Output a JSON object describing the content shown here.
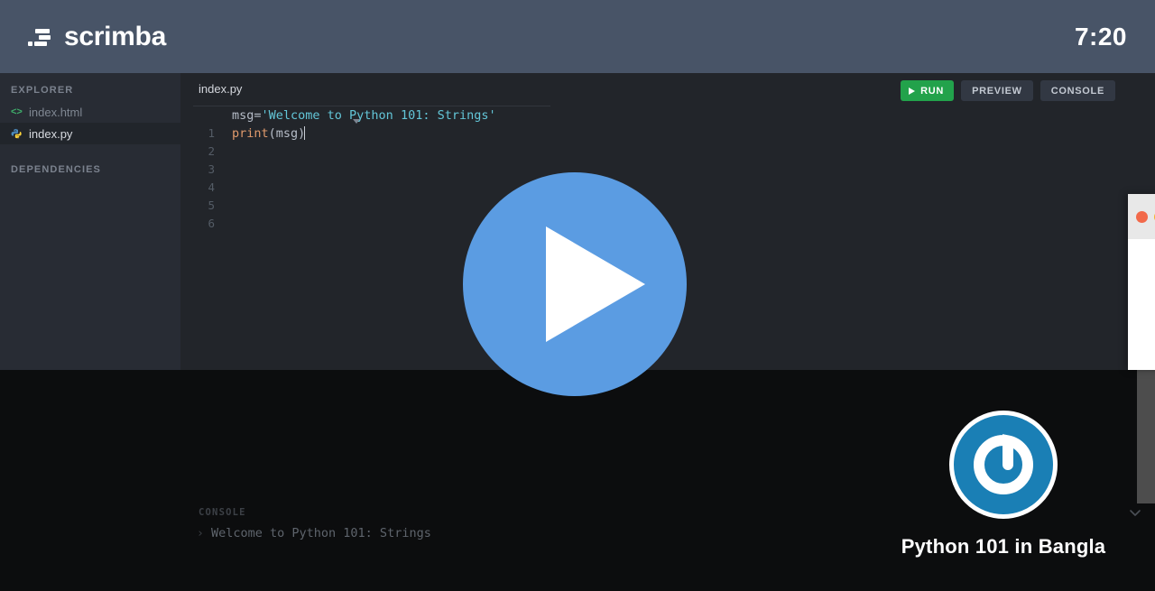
{
  "header": {
    "brand_name": "scrimba",
    "logo_icon": "scrimba-logo-icon",
    "clock": "7:20"
  },
  "sidebar": {
    "explorer_title": "EXPLORER",
    "dependencies_title": "DEPENDENCIES",
    "files": [
      {
        "label": "index.html",
        "icon": "code-brackets-icon",
        "icon_text": "<>",
        "active": false
      },
      {
        "label": "index.py",
        "icon": "python-icon",
        "icon_text": "",
        "active": true
      }
    ]
  },
  "editor": {
    "tab_label": "index.py",
    "toolbar": {
      "run_label": "RUN",
      "run_icon": "play-icon",
      "preview_label": "PREVIEW",
      "console_label": "CONSOLE"
    },
    "line_numbers": [
      "1",
      "2",
      "3",
      "4",
      "5",
      "6"
    ],
    "lines": [
      {
        "plain": "msg=",
        "string": "'Welcome to Python 101: Strings'",
        "fn": ""
      },
      {
        "fn": "print",
        "plain": "(msg)",
        "string": ""
      }
    ]
  },
  "console": {
    "title": "CONSOLE",
    "collapse_icon": "chevron-down-icon",
    "prompt": "›",
    "output": "Welcome to Python 101: Strings"
  },
  "overlay": {
    "play_icon": "play-button-icon",
    "play_color": "#5b9ce2"
  },
  "branding": {
    "logo_icon": "power-spiral-logo-icon",
    "caption": "Python 101 in Bangla",
    "logo_color": "#1a7fb5"
  },
  "preview_window": {
    "traffic_lights": [
      "#f2694a",
      "#f5b429"
    ],
    "close_dot_name": "window-close-dot",
    "minimize_dot_name": "window-minimize-dot"
  }
}
